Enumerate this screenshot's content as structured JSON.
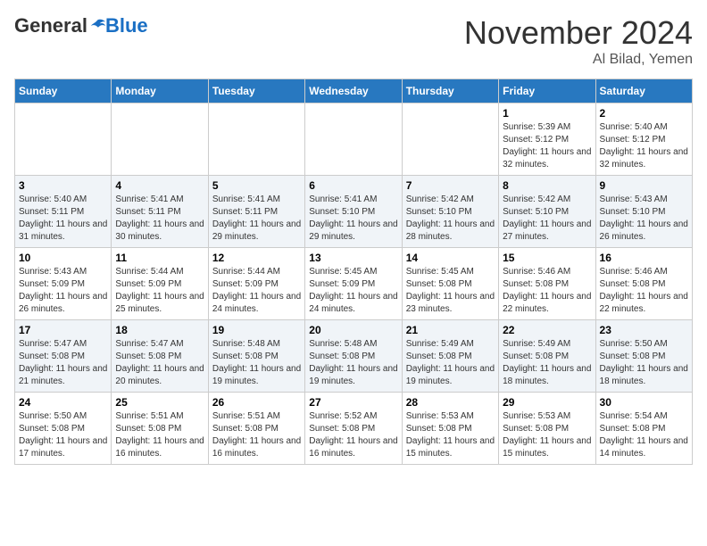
{
  "header": {
    "logo_general": "General",
    "logo_blue": "Blue",
    "month_title": "November 2024",
    "location": "Al Bilad, Yemen"
  },
  "weekdays": [
    "Sunday",
    "Monday",
    "Tuesday",
    "Wednesday",
    "Thursday",
    "Friday",
    "Saturday"
  ],
  "weeks": [
    [
      {
        "day": "",
        "info": ""
      },
      {
        "day": "",
        "info": ""
      },
      {
        "day": "",
        "info": ""
      },
      {
        "day": "",
        "info": ""
      },
      {
        "day": "",
        "info": ""
      },
      {
        "day": "1",
        "info": "Sunrise: 5:39 AM\nSunset: 5:12 PM\nDaylight: 11 hours and 32 minutes."
      },
      {
        "day": "2",
        "info": "Sunrise: 5:40 AM\nSunset: 5:12 PM\nDaylight: 11 hours and 32 minutes."
      }
    ],
    [
      {
        "day": "3",
        "info": "Sunrise: 5:40 AM\nSunset: 5:11 PM\nDaylight: 11 hours and 31 minutes."
      },
      {
        "day": "4",
        "info": "Sunrise: 5:41 AM\nSunset: 5:11 PM\nDaylight: 11 hours and 30 minutes."
      },
      {
        "day": "5",
        "info": "Sunrise: 5:41 AM\nSunset: 5:11 PM\nDaylight: 11 hours and 29 minutes."
      },
      {
        "day": "6",
        "info": "Sunrise: 5:41 AM\nSunset: 5:10 PM\nDaylight: 11 hours and 29 minutes."
      },
      {
        "day": "7",
        "info": "Sunrise: 5:42 AM\nSunset: 5:10 PM\nDaylight: 11 hours and 28 minutes."
      },
      {
        "day": "8",
        "info": "Sunrise: 5:42 AM\nSunset: 5:10 PM\nDaylight: 11 hours and 27 minutes."
      },
      {
        "day": "9",
        "info": "Sunrise: 5:43 AM\nSunset: 5:10 PM\nDaylight: 11 hours and 26 minutes."
      }
    ],
    [
      {
        "day": "10",
        "info": "Sunrise: 5:43 AM\nSunset: 5:09 PM\nDaylight: 11 hours and 26 minutes."
      },
      {
        "day": "11",
        "info": "Sunrise: 5:44 AM\nSunset: 5:09 PM\nDaylight: 11 hours and 25 minutes."
      },
      {
        "day": "12",
        "info": "Sunrise: 5:44 AM\nSunset: 5:09 PM\nDaylight: 11 hours and 24 minutes."
      },
      {
        "day": "13",
        "info": "Sunrise: 5:45 AM\nSunset: 5:09 PM\nDaylight: 11 hours and 24 minutes."
      },
      {
        "day": "14",
        "info": "Sunrise: 5:45 AM\nSunset: 5:08 PM\nDaylight: 11 hours and 23 minutes."
      },
      {
        "day": "15",
        "info": "Sunrise: 5:46 AM\nSunset: 5:08 PM\nDaylight: 11 hours and 22 minutes."
      },
      {
        "day": "16",
        "info": "Sunrise: 5:46 AM\nSunset: 5:08 PM\nDaylight: 11 hours and 22 minutes."
      }
    ],
    [
      {
        "day": "17",
        "info": "Sunrise: 5:47 AM\nSunset: 5:08 PM\nDaylight: 11 hours and 21 minutes."
      },
      {
        "day": "18",
        "info": "Sunrise: 5:47 AM\nSunset: 5:08 PM\nDaylight: 11 hours and 20 minutes."
      },
      {
        "day": "19",
        "info": "Sunrise: 5:48 AM\nSunset: 5:08 PM\nDaylight: 11 hours and 19 minutes."
      },
      {
        "day": "20",
        "info": "Sunrise: 5:48 AM\nSunset: 5:08 PM\nDaylight: 11 hours and 19 minutes."
      },
      {
        "day": "21",
        "info": "Sunrise: 5:49 AM\nSunset: 5:08 PM\nDaylight: 11 hours and 19 minutes."
      },
      {
        "day": "22",
        "info": "Sunrise: 5:49 AM\nSunset: 5:08 PM\nDaylight: 11 hours and 18 minutes."
      },
      {
        "day": "23",
        "info": "Sunrise: 5:50 AM\nSunset: 5:08 PM\nDaylight: 11 hours and 18 minutes."
      }
    ],
    [
      {
        "day": "24",
        "info": "Sunrise: 5:50 AM\nSunset: 5:08 PM\nDaylight: 11 hours and 17 minutes."
      },
      {
        "day": "25",
        "info": "Sunrise: 5:51 AM\nSunset: 5:08 PM\nDaylight: 11 hours and 16 minutes."
      },
      {
        "day": "26",
        "info": "Sunrise: 5:51 AM\nSunset: 5:08 PM\nDaylight: 11 hours and 16 minutes."
      },
      {
        "day": "27",
        "info": "Sunrise: 5:52 AM\nSunset: 5:08 PM\nDaylight: 11 hours and 16 minutes."
      },
      {
        "day": "28",
        "info": "Sunrise: 5:53 AM\nSunset: 5:08 PM\nDaylight: 11 hours and 15 minutes."
      },
      {
        "day": "29",
        "info": "Sunrise: 5:53 AM\nSunset: 5:08 PM\nDaylight: 11 hours and 15 minutes."
      },
      {
        "day": "30",
        "info": "Sunrise: 5:54 AM\nSunset: 5:08 PM\nDaylight: 11 hours and 14 minutes."
      }
    ]
  ]
}
